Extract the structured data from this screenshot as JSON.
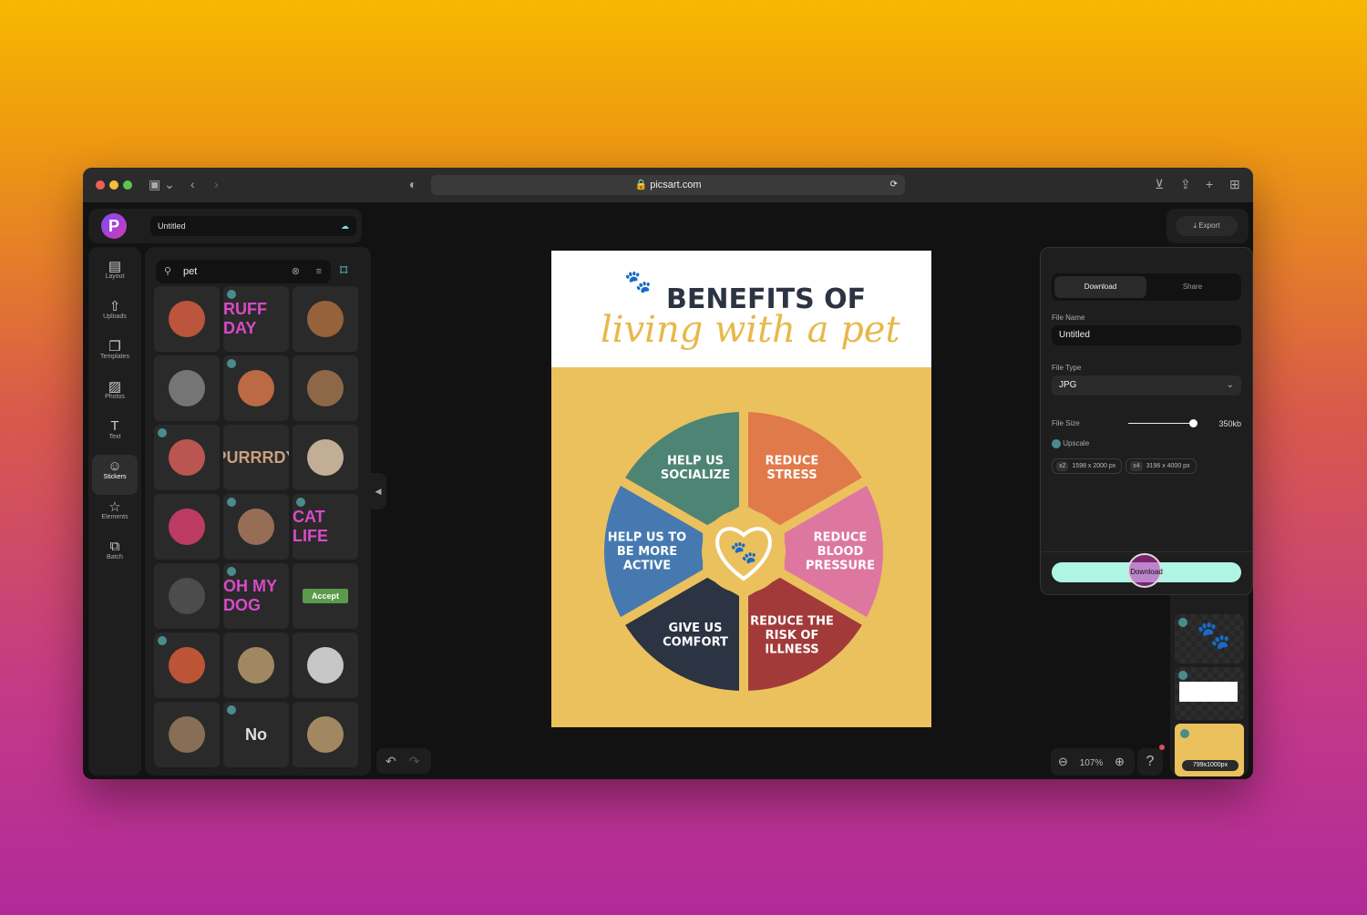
{
  "browser": {
    "url": "picsart.com"
  },
  "header": {
    "project_name": "Untitled",
    "export_label": "Export"
  },
  "sidebar": {
    "items": [
      {
        "label": "Layout",
        "icon": "layout-icon"
      },
      {
        "label": "Uploads",
        "icon": "upload-icon"
      },
      {
        "label": "Templates",
        "icon": "book-icon"
      },
      {
        "label": "Photos",
        "icon": "image-icon"
      },
      {
        "label": "Text",
        "icon": "text-icon"
      },
      {
        "label": "Stickers",
        "icon": "sticker-icon",
        "active": true
      },
      {
        "label": "Elements",
        "icon": "star-icon"
      },
      {
        "label": "Batch",
        "icon": "batch-icon"
      }
    ]
  },
  "search": {
    "value": "pet"
  },
  "stickers": [
    "",
    "RUFF DAY",
    "",
    "",
    "",
    "",
    "",
    "PURRRDY",
    "",
    "",
    "",
    "CAT LIFE",
    "",
    "OH MY DOG",
    "Accept",
    "",
    "",
    "",
    "",
    "No",
    ""
  ],
  "poster": {
    "title": "BENEFITS OF",
    "subtitle": "living with a pet",
    "segments": [
      {
        "label": "REDUCE STRESS",
        "color": "#e07a4a"
      },
      {
        "label": "REDUCE BLOOD PRESSURE",
        "color": "#dd77a0"
      },
      {
        "label": "REDUCE THE RISK OF ILLNESS",
        "color": "#a23a3a"
      },
      {
        "label": "GIVE US COMFORT",
        "color": "#2c3342"
      },
      {
        "label": "HELP US TO BE MORE ACTIVE",
        "color": "#4679b0"
      },
      {
        "label": "HELP US SOCIALIZE",
        "color": "#4e8474"
      }
    ],
    "bg": "#ebc15d",
    "accent": "#e8b84a"
  },
  "export_panel": {
    "tabs": [
      "Download",
      "Share"
    ],
    "file_name_label": "File Name",
    "file_name": "Untitled",
    "file_type_label": "File Type",
    "file_type": "JPG",
    "file_size_label": "File Size",
    "file_size": "350kb",
    "file_size_level": 1.0,
    "upscale_label": "Upscale",
    "upscale_options": [
      {
        "factor": "x2",
        "size": "1598 x 2000 px"
      },
      {
        "factor": "x4",
        "size": "3196 x 4000 px"
      }
    ],
    "download_label": "Download",
    "download_color": "#aef5e6"
  },
  "zoom": {
    "level": "107%"
  },
  "pages": {
    "size_label": "799x1000px"
  }
}
